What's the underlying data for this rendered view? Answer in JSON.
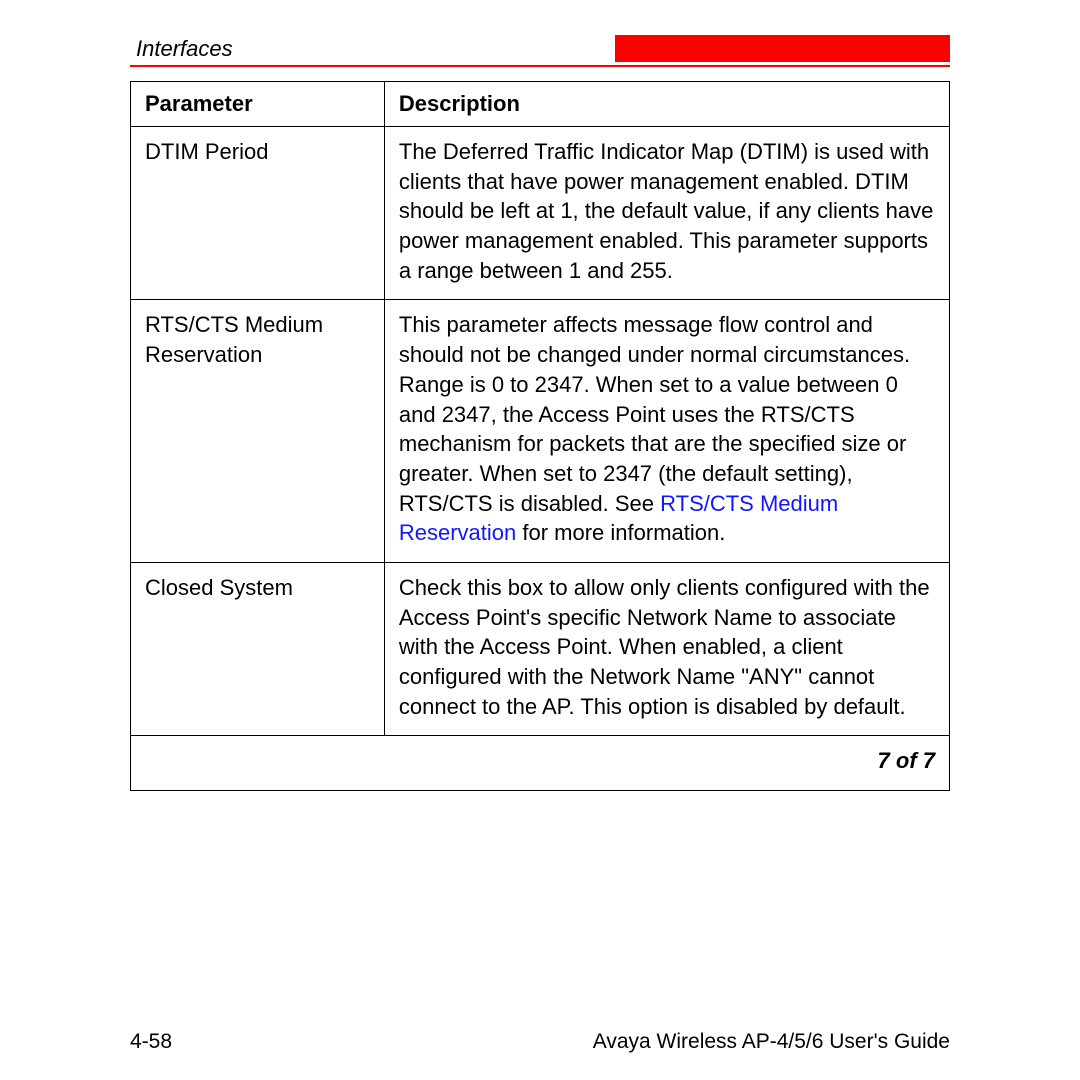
{
  "header": {
    "section": "Interfaces"
  },
  "table": {
    "headers": {
      "parameter": "Parameter",
      "description": "Description"
    },
    "rows": [
      {
        "parameter": "DTIM Period",
        "description": "The Deferred Traffic Indicator Map (DTIM) is used with clients that have power management enabled. DTIM should be left at 1, the default value, if any clients have power management enabled. This parameter supports a range between 1 and 255."
      },
      {
        "parameter": "RTS/CTS Medium Reservation",
        "desc_before_link": "This parameter affects message flow control and should not be changed under normal circumstances. Range is 0 to 2347. When set to a value between 0 and 2347, the Access Point uses the RTS/CTS mechanism for packets that are the specified size or greater. When set to 2347 (the default setting), RTS/CTS is disabled. See ",
        "link_text": "RTS/CTS Medium Reservation",
        "desc_after_link": " for more information."
      },
      {
        "parameter": "Closed System",
        "description": "Check this box to allow only clients configured with the Access Point's specific Network Name to associate with the Access Point. When enabled, a client configured with the Network Name \"ANY\" cannot connect to the AP. This option is disabled by default."
      }
    ],
    "pager": "7 of 7"
  },
  "footer": {
    "page_number": "4-58",
    "doc_title": "Avaya Wireless AP-4/5/6 User's Guide"
  }
}
